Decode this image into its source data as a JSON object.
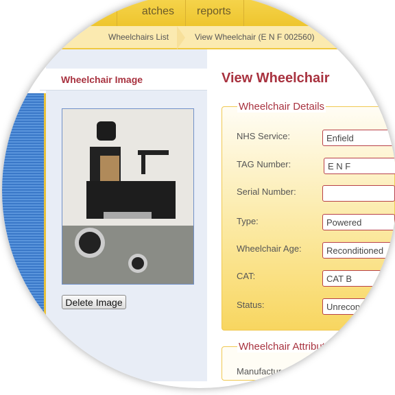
{
  "nav": {
    "items": [
      "atches",
      "reports"
    ]
  },
  "breadcrumb": [
    "Wheelchairs List",
    "View Wheelchair (E N F 002560)"
  ],
  "left": {
    "heading": "Wheelchair Image",
    "delete_label": "Delete Image"
  },
  "main": {
    "title": "View Wheelchair",
    "details": {
      "legend": "Wheelchair Details",
      "fields": [
        {
          "label": "NHS Service:",
          "value": "Enfield"
        },
        {
          "label": "TAG Number:",
          "value": "E N F"
        },
        {
          "label": "Serial Number:",
          "value": ""
        },
        {
          "label": "Type:",
          "value": "Powered"
        },
        {
          "label": "Wheelchair Age:",
          "value": "Reconditioned"
        },
        {
          "label": "CAT:",
          "value": "CAT B"
        },
        {
          "label": "Status:",
          "value": "Unrecon"
        }
      ]
    },
    "attributes": {
      "legend": "Wheelchair Attributes",
      "first_label": "Manufacturer"
    }
  },
  "colors": {
    "accent": "#a8323f",
    "nav": "#eec52e",
    "sidebar": "#3a78c8"
  }
}
